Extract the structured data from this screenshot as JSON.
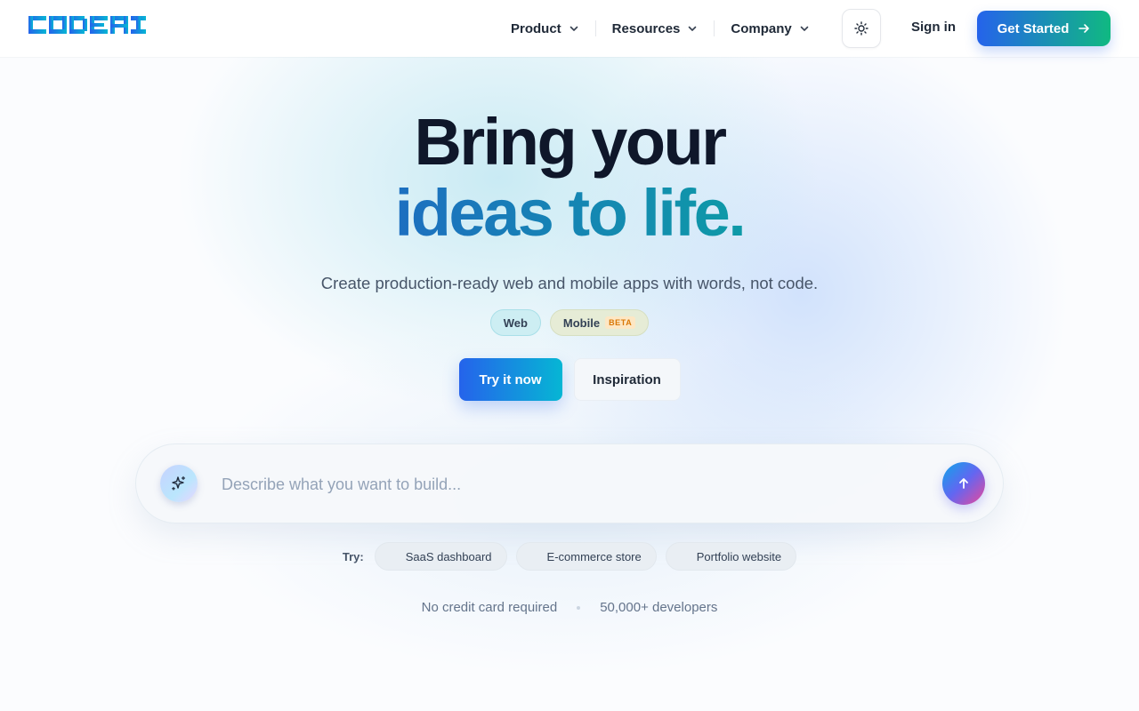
{
  "brand": {
    "logo_text": "CODEAI"
  },
  "nav": {
    "items": [
      {
        "label": "Product"
      },
      {
        "label": "Resources"
      },
      {
        "label": "Company"
      }
    ],
    "sign_in": "Sign in",
    "get_started": "Get Started"
  },
  "hero": {
    "line1": "Bring your",
    "line2": "ideas to life.",
    "subtitle": "Create production-ready web and mobile apps with words, not code.",
    "platform_pills": [
      {
        "label": "Web"
      },
      {
        "label": "Mobile",
        "badge": "BETA"
      }
    ],
    "try_button": "Try it now",
    "inspiration_button": "Inspiration"
  },
  "prompt": {
    "placeholder": "Describe what you want to build...",
    "value": ""
  },
  "suggestions": {
    "label": "Try:",
    "items": [
      "SaaS dashboard",
      "E-commerce store",
      "Portfolio website"
    ]
  },
  "footer_note": {
    "left": "No credit card required",
    "right": "50,000+ developers"
  },
  "icons": {
    "theme": "sun-icon",
    "get_started": "arrow-right-icon",
    "prompt_left": "sparkles-icon",
    "send": "arrow-up-icon",
    "nav_dropdown": "chevron-down-icon"
  },
  "colors": {
    "primary_blue": "#2563eb",
    "accent_green": "#10b981",
    "accent_cyan": "#06b6d4",
    "heading": "#0f172a",
    "gradient_text_start": "#1d6fc0",
    "gradient_text_end": "#0e9aa7"
  }
}
